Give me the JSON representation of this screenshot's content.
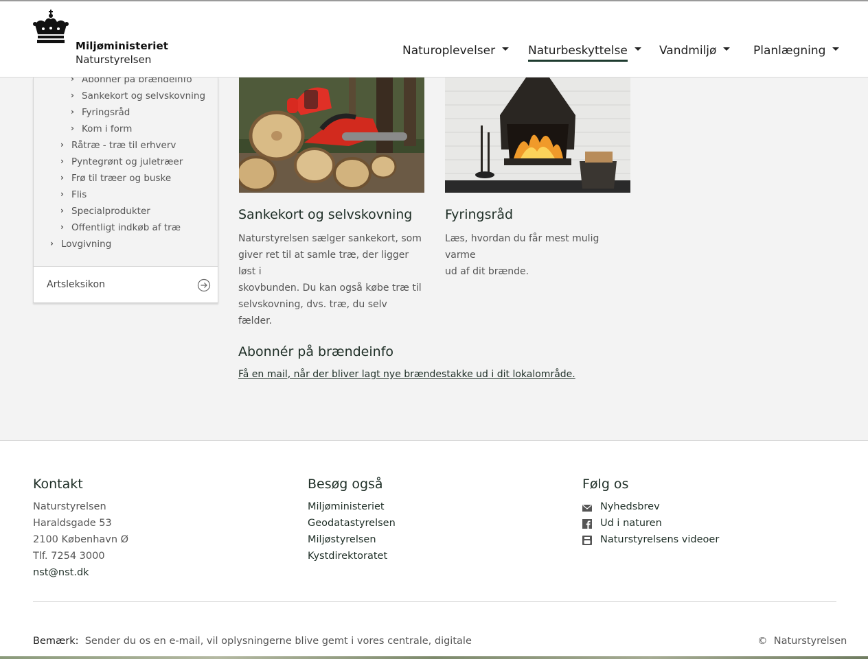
{
  "header": {
    "org_name": "Miljøministeriet",
    "agency_name": "Naturstyrelsen",
    "nav": [
      {
        "label": "Naturoplevelser"
      },
      {
        "label": "Naturbeskyttelse"
      },
      {
        "label": "Vandmiljø"
      },
      {
        "label": "Planlægning"
      }
    ]
  },
  "sidebar": {
    "items": [
      {
        "label": "Abonnér på brændeinfo"
      },
      {
        "label": "Sankekort og selvskovning"
      },
      {
        "label": "Fyringsråd"
      },
      {
        "label": "Kom i form"
      },
      {
        "label": "Råtræ - træ til erhverv"
      },
      {
        "label": "Pyntegrønt og juletræer"
      },
      {
        "label": "Frø til træer og buske"
      },
      {
        "label": "Flis"
      },
      {
        "label": "Specialprodukter"
      },
      {
        "label": "Offentligt indkøb af træ"
      },
      {
        "label": "Lovgivning"
      }
    ],
    "artsleksikon": "Artsleksikon"
  },
  "cards": [
    {
      "title": "Sankekort og selvskovning",
      "lines": [
        "Naturstyrelsen sælger sankekort, som",
        "giver ret til at samle træ, der ligger løst i",
        "skovbunden. Du kan også købe træ til",
        "selvskovning, dvs. træ, du selv fælder."
      ]
    },
    {
      "title": "Fyringsråd",
      "lines": [
        "Læs, hvordan du får mest mulig varme",
        "ud af dit brænde."
      ]
    }
  ],
  "subscribe": {
    "title": "Abonnér på brændeinfo",
    "link": "Få en mail, når der bliver lagt nye brændestakke ud i dit lokalområde."
  },
  "footer": {
    "contact": {
      "heading": "Kontakt",
      "lines": [
        "Naturstyrelsen",
        "Haraldsgade 53",
        "2100 København Ø",
        "Tlf. 7254 3000"
      ],
      "email": "nst@nst.dk"
    },
    "visit": {
      "heading": "Besøg også",
      "links": [
        "Miljøministeriet",
        "Geodatastyrelsen",
        "Miljøstyrelsen",
        "Kystdirektoratet"
      ]
    },
    "follow": {
      "heading": "Følg os",
      "links": [
        {
          "label": "Nyhedsbrev",
          "icon": "mail-icon"
        },
        {
          "label": "Ud i naturen",
          "icon": "facebook-icon"
        },
        {
          "label": "Naturstyrelsens videoer",
          "icon": "youtube-icon"
        }
      ]
    },
    "note_label": "Bemærk:",
    "note_text": "Sender du os en e-mail, vil oplysningerne blive gemt i vores centrale, digitale",
    "copyright_symbol": "©",
    "copyright": "Naturstyrelsen"
  }
}
